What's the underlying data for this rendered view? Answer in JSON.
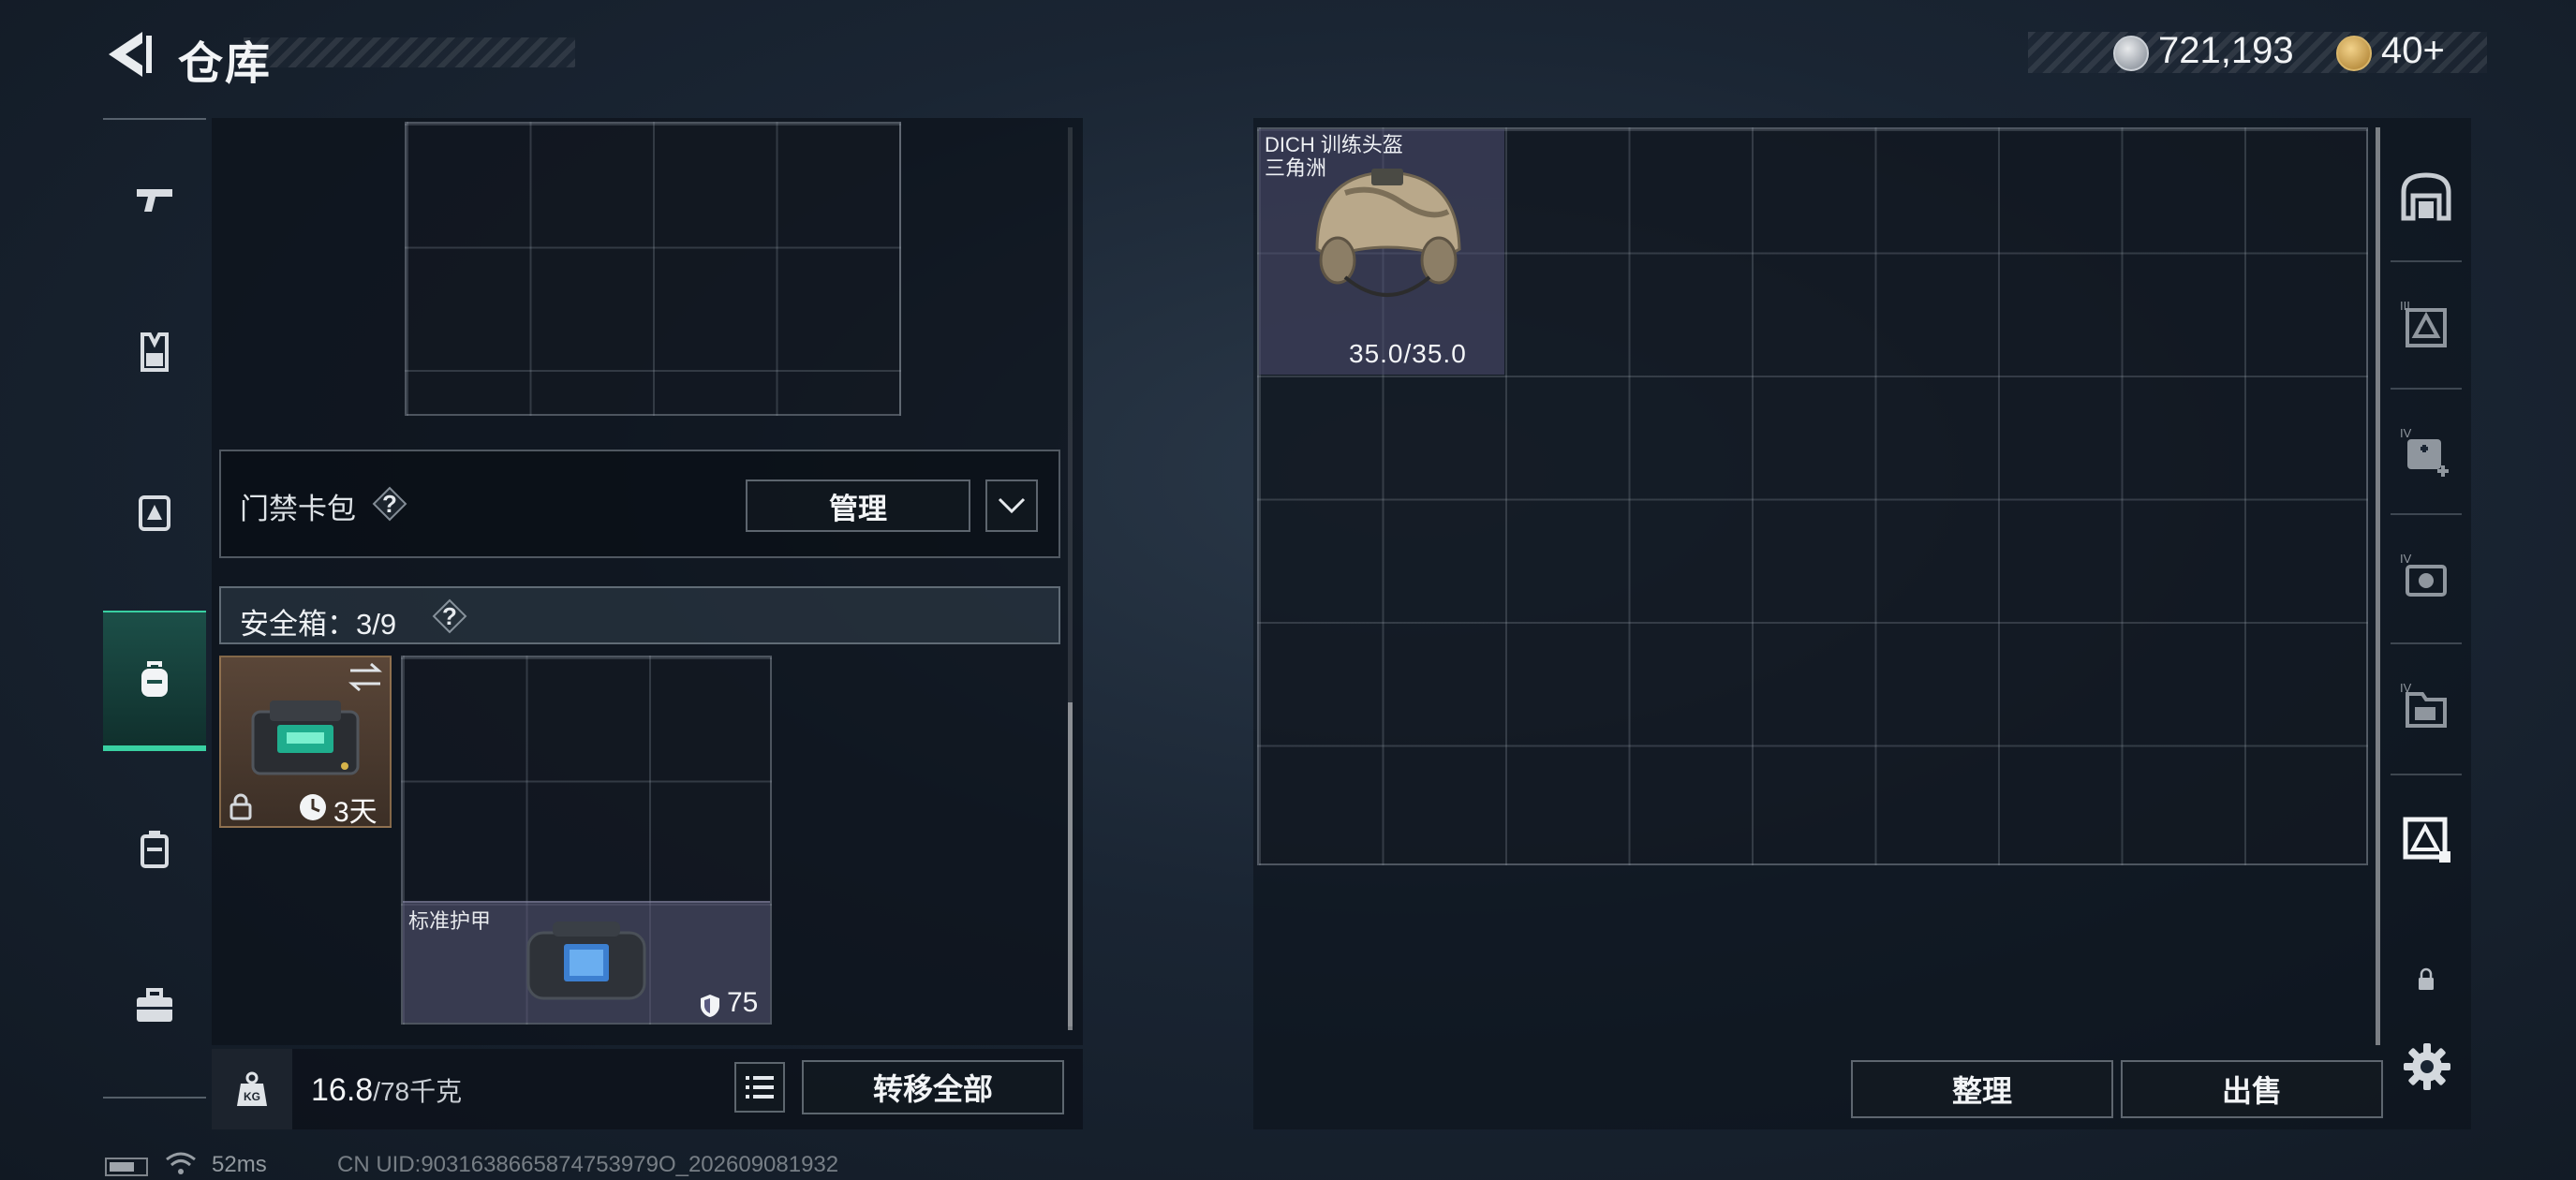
{
  "header": {
    "title": "仓库",
    "currency": {
      "coins": "721,193",
      "tokens": "40",
      "tokens_plus": "+"
    }
  },
  "icons": {
    "back": "back-arrow-icon",
    "coin": "coin-icon",
    "token": "token-icon",
    "left_nav": [
      "pistol-icon",
      "vest-icon",
      "chest-rig-icon",
      "backpack-icon",
      "case-icon",
      "toolbox-icon"
    ],
    "right_nav": [
      "stash-home-icon",
      "stash-page-3-icon",
      "stash-page-4-medical-icon",
      "stash-page-4-camera-icon",
      "stash-page-4-files-icon",
      "stash-page-active-icon",
      "lock-icon"
    ],
    "settings": "gear-icon"
  },
  "left_panel": {
    "card_pack": {
      "label": "门禁卡包",
      "help": "?",
      "manage_label": "管理"
    },
    "safebox": {
      "label": "安全箱：3/9",
      "help": "?",
      "item_days": "3天"
    },
    "armor_item": {
      "name": "标准护甲",
      "value": "75"
    },
    "weight": {
      "current": "16.8",
      "max": "/78千克"
    },
    "transfer_all_label": "转移全部"
  },
  "stash": {
    "helmet": {
      "name_line1": "DICH 训练头盔",
      "name_line2": "三角洲",
      "durability": "35.0/35.0"
    },
    "sort_label": "整理",
    "sell_label": "出售"
  },
  "status": {
    "ping": "52ms",
    "uid": "CN UID:9031638665874753979O_202609081932"
  },
  "colors": {
    "accent": "#39d0a2",
    "panel": "#0c121a",
    "item_bg": "#50507a"
  }
}
